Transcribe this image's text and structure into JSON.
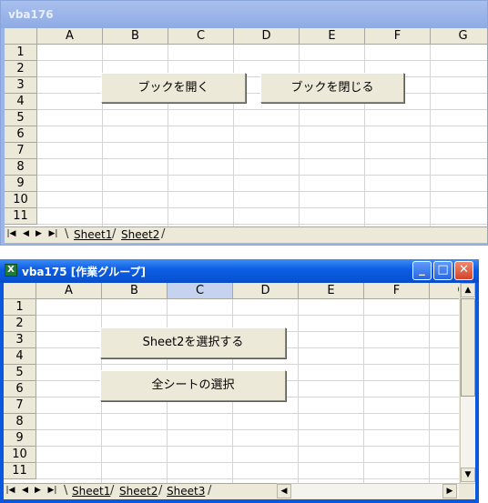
{
  "window1": {
    "title": "vba176",
    "columns": [
      "A",
      "B",
      "C",
      "D",
      "E",
      "F",
      "G"
    ],
    "rows": [
      "1",
      "2",
      "3",
      "4",
      "5",
      "6",
      "7",
      "8",
      "9",
      "10",
      "11"
    ],
    "buttons": {
      "open_book": "ブックを開く",
      "close_book": "ブックを閉じる"
    },
    "sheet_tabs": [
      "Sheet1",
      "Sheet2"
    ],
    "nav_icons": [
      "first-sheet-icon",
      "prev-sheet-icon",
      "next-sheet-icon",
      "last-sheet-icon"
    ]
  },
  "window2": {
    "title": "vba175  [作業グループ]",
    "columns": [
      "A",
      "B",
      "C",
      "D",
      "E",
      "F",
      "G"
    ],
    "selected_column": "C",
    "rows": [
      "1",
      "2",
      "3",
      "4",
      "5",
      "6",
      "7",
      "8",
      "9",
      "10",
      "11"
    ],
    "buttons": {
      "select_sheet2": "Sheet2を選択する",
      "select_all": "全シートの選択"
    },
    "sheet_tabs": [
      "Sheet1",
      "Sheet2",
      "Sheet3"
    ],
    "window_controls": [
      "minimize-icon",
      "maximize-icon",
      "close-icon"
    ]
  }
}
